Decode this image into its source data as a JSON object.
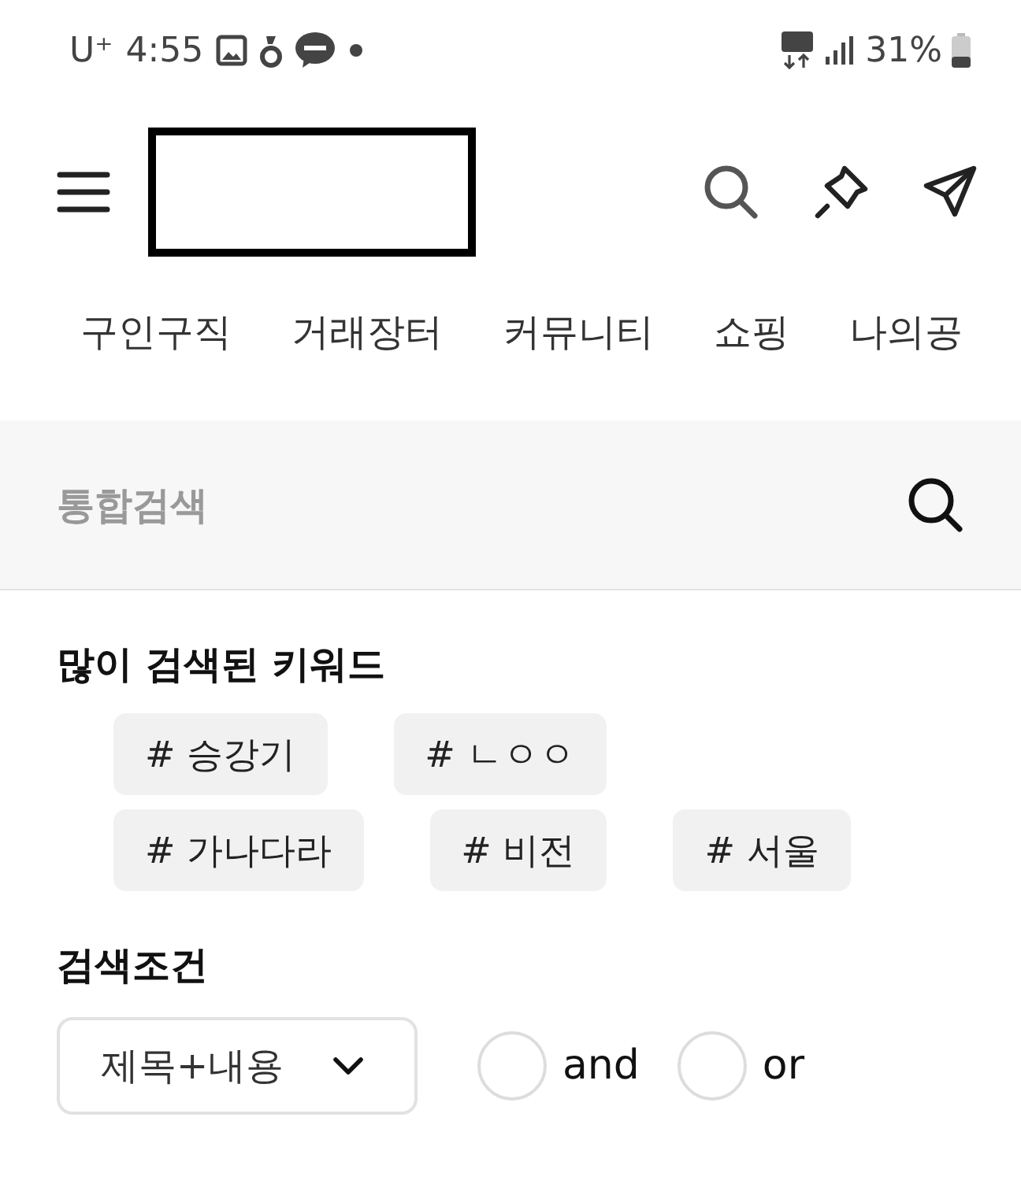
{
  "status_bar": {
    "carrier": "U⁺",
    "time": "4:55",
    "battery": "31%"
  },
  "header": {
    "tabs": [
      {
        "label": "구인구직",
        "selected": false
      },
      {
        "label": "거래장터",
        "selected": false
      },
      {
        "label": "커뮤니티",
        "selected": false
      },
      {
        "label": "쇼핑",
        "selected": false
      },
      {
        "label": "나의공",
        "selected": false
      }
    ]
  },
  "search": {
    "placeholder": "통합검색"
  },
  "popular_keywords": {
    "title": "많이 검색된 키워드",
    "items": [
      "# 승강기",
      "# ㄴㅇㅇ",
      "# 가나다라",
      "# 비전",
      "# 서울"
    ]
  },
  "search_conditions": {
    "title": "검색조건",
    "dropdown": "제목+내용",
    "options": [
      {
        "label": "and",
        "selected": false
      },
      {
        "label": "or",
        "selected": false
      }
    ]
  }
}
